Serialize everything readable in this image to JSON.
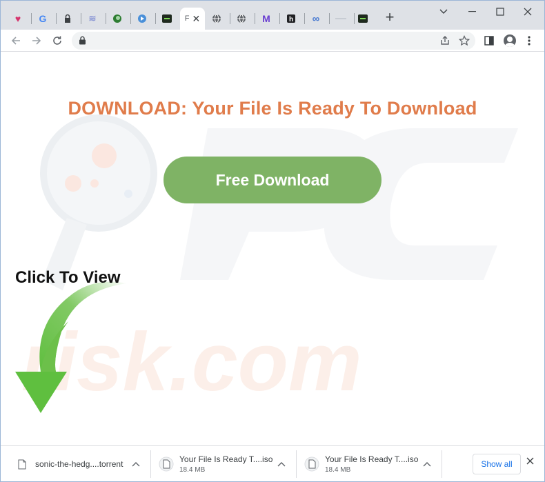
{
  "tabs": {
    "active_title": "F",
    "close_glyph": "✕",
    "new_tab_glyph": "+",
    "favicons": [
      "heart-favicon",
      "google-favicon",
      "lock-favicon",
      "waves-favicon",
      "circle-green-favicon",
      "circle-blue-favicon",
      "terminal-favicon",
      "globe-favicon",
      "globe-favicon",
      "m-favicon",
      "h-favicon",
      "infinity-favicon",
      "dash-favicon",
      "terminal-favicon"
    ]
  },
  "window_controls": {
    "chevron": "⌄",
    "minimize": "—",
    "maximize": "☐",
    "close": "✕"
  },
  "toolbar": {
    "back": "←",
    "forward": "→",
    "reload": "⟳",
    "url": ""
  },
  "page": {
    "headline": "DOWNLOAD: Your File Is Ready To Download",
    "button_label": "Free Download",
    "click_label": "Click To View"
  },
  "downloads": {
    "items": [
      {
        "name": "sonic-the-hedg....torrent",
        "size": ""
      },
      {
        "name": "Your File Is Ready T....iso",
        "size": "18.4 MB"
      },
      {
        "name": "Your File Is Ready T....iso",
        "size": "18.4 MB"
      }
    ],
    "chevron": "⌃",
    "show_all": "Show all",
    "close": "✕"
  },
  "colors": {
    "headline": "#e07c4b",
    "button": "#7fb365",
    "arrow": "#6cc04a",
    "link": "#1a73e8"
  }
}
